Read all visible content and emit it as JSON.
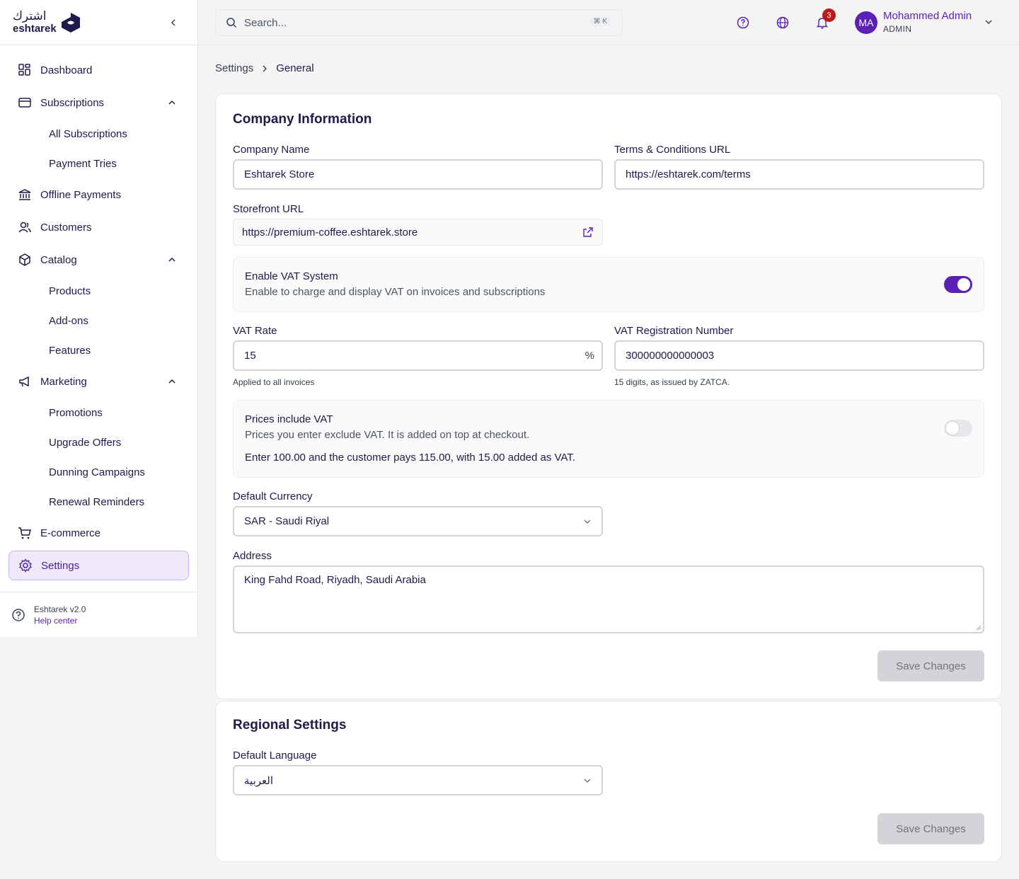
{
  "brand": {
    "name_ar": "اشترك",
    "name_en": "eshtarek",
    "color": "#5b21b6"
  },
  "sidebar": {
    "items": [
      {
        "label": "Dashboard",
        "icon": "grid-icon"
      },
      {
        "label": "Subscriptions",
        "icon": "card-icon",
        "children": [
          "All Subscriptions",
          "Payment Tries"
        ]
      },
      {
        "label": "Offline Payments",
        "icon": "bank-icon"
      },
      {
        "label": "Customers",
        "icon": "users-icon"
      },
      {
        "label": "Catalog",
        "icon": "box-icon",
        "children": [
          "Products",
          "Add-ons",
          "Features"
        ]
      },
      {
        "label": "Marketing",
        "icon": "megaphone-icon",
        "children": [
          "Promotions",
          "Upgrade Offers",
          "Dunning Campaigns",
          "Renewal Reminders"
        ]
      },
      {
        "label": "E-commerce",
        "icon": "cart-icon"
      },
      {
        "label": "Settings",
        "icon": "gear-icon",
        "active": true
      }
    ],
    "footer": {
      "version": "Eshtarek v2.0",
      "help": "Help center"
    }
  },
  "header": {
    "search_placeholder": "Search...",
    "shortcut": "⌘ K",
    "notifications_count": "3",
    "user": {
      "initials": "MA",
      "name": "Mohammed Admin",
      "role": "ADMIN"
    }
  },
  "breadcrumb": {
    "parent": "Settings",
    "current": "General"
  },
  "company": {
    "title": "Company Information",
    "company_name_label": "Company Name",
    "company_name": "Eshtarek Store",
    "terms_label": "Terms & Conditions URL",
    "terms_url": "https://eshtarek.com/terms",
    "storefront_label": "Storefront URL",
    "storefront_url": "https://premium-coffee.eshtarek.store",
    "vat_toggle": {
      "title": "Enable VAT System",
      "description": "Enable to charge and display VAT on invoices and subscriptions",
      "enabled": true
    },
    "vat_rate_label": "VAT Rate",
    "vat_rate": "15",
    "vat_rate_suffix": "%",
    "vat_rate_hint": "Applied to all invoices",
    "vat_reg_label": "VAT Registration Number",
    "vat_reg": "300000000000003",
    "vat_reg_hint": "15 digits, as issued by ZATCA.",
    "prices_toggle": {
      "title": "Prices include VAT",
      "description": "Prices you enter exclude VAT. It is added on top at checkout.",
      "example": "Enter 100.00 and the customer pays 115.00, with 15.00 added as VAT.",
      "enabled": false
    },
    "currency_label": "Default Currency",
    "currency": "SAR - Saudi Riyal",
    "address_label": "Address",
    "address": "King Fahd Road, Riyadh, Saudi Arabia",
    "save": "Save Changes"
  },
  "regional": {
    "title": "Regional Settings",
    "language_label": "Default Language",
    "language": "العربية",
    "save": "Save Changes"
  }
}
